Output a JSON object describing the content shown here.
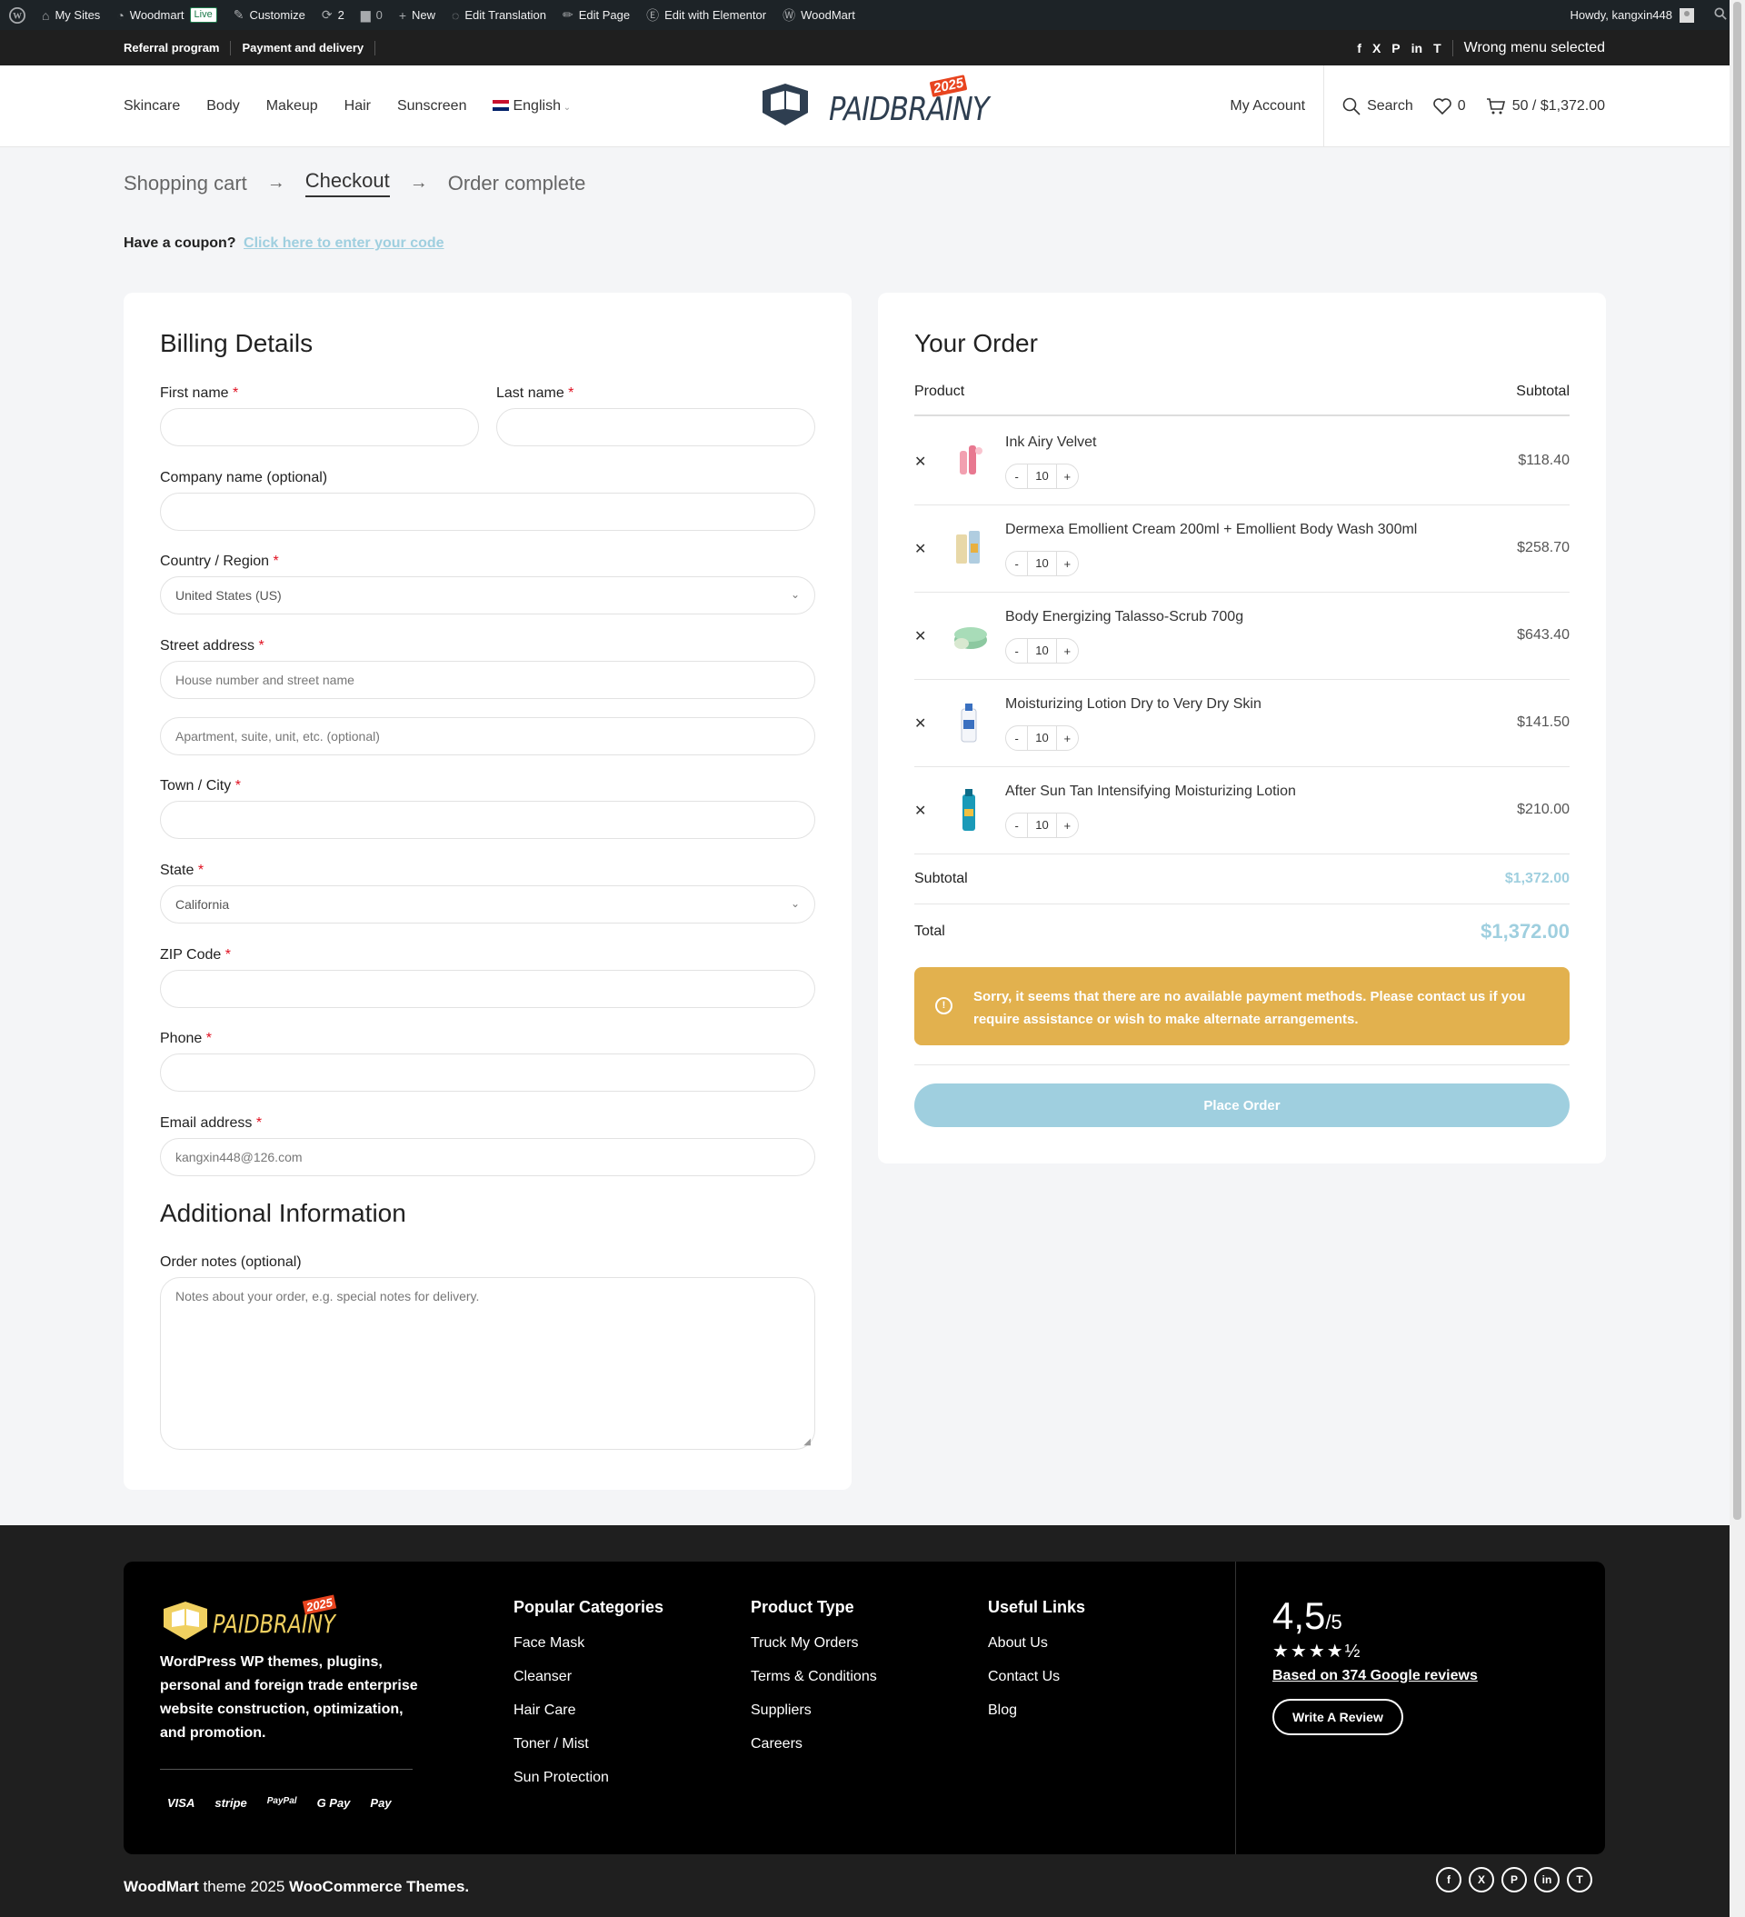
{
  "adminbar": {
    "items": [
      {
        "label": "My Sites",
        "icon": "my-sites-icon"
      },
      {
        "label": "Woodmart",
        "badge": "Live",
        "icon": "home-icon"
      },
      {
        "label": "Customize",
        "icon": "brush-icon"
      },
      {
        "label": "2",
        "icon": "updates-icon"
      },
      {
        "label": "0",
        "icon": "comments-icon"
      },
      {
        "label": "New",
        "icon": "plus-icon"
      },
      {
        "label": "Edit Translation",
        "icon": "translate-icon"
      },
      {
        "label": "Edit Page",
        "icon": "pencil-icon"
      },
      {
        "label": "Edit with Elementor",
        "icon": "elementor-icon"
      },
      {
        "label": "WoodMart",
        "icon": "woodmart-icon"
      }
    ],
    "howdy": "Howdy, kangxin448"
  },
  "topbar": {
    "links": [
      "Referral program",
      "Payment and delivery"
    ],
    "social": [
      "f",
      "X",
      "P",
      "in",
      "T"
    ],
    "menu_notice": "Wrong menu selected"
  },
  "header": {
    "nav": [
      "Skincare",
      "Body",
      "Makeup",
      "Hair",
      "Sunscreen"
    ],
    "language": "English",
    "logo_text": "PAIDBRAINY",
    "logo_year": "2025",
    "my_account": "My Account",
    "search": "Search",
    "wishlist_count": "0",
    "cart": "50 / $1,372.00"
  },
  "steps": {
    "cart": "Shopping cart",
    "checkout": "Checkout",
    "complete": "Order complete"
  },
  "coupon": {
    "text": "Have a coupon?",
    "link": "Click here to enter your code"
  },
  "billing": {
    "title": "Billing Details",
    "first_name": "First name",
    "last_name": "Last name",
    "company": "Company name (optional)",
    "country_label": "Country / Region",
    "country_value": "United States (US)",
    "street_label": "Street address",
    "street_ph1": "House number and street name",
    "street_ph2": "Apartment, suite, unit, etc. (optional)",
    "city": "Town / City",
    "state_label": "State",
    "state_value": "California",
    "zip": "ZIP Code",
    "phone": "Phone",
    "email_label": "Email address",
    "email_value": "kangxin448@126.com",
    "additional_title": "Additional Information",
    "notes_label": "Order notes (optional)",
    "notes_ph": "Notes about your order, e.g. special notes for delivery."
  },
  "order": {
    "title": "Your Order",
    "col_product": "Product",
    "col_subtotal": "Subtotal",
    "items": [
      {
        "name": "Ink Airy Velvet",
        "qty": "10",
        "price": "$118.40"
      },
      {
        "name": "Dermexa Emollient Cream 200ml + Emollient Body Wash 300ml",
        "qty": "10",
        "price": "$258.70"
      },
      {
        "name": "Body Energizing Talasso-Scrub 700g",
        "qty": "10",
        "price": "$643.40"
      },
      {
        "name": "Moisturizing Lotion Dry to Very Dry Skin",
        "qty": "10",
        "price": "$141.50"
      },
      {
        "name": "After Sun Tan Intensifying Moisturizing Lotion",
        "qty": "10",
        "price": "$210.00"
      }
    ],
    "subtotal_label": "Subtotal",
    "subtotal_value": "$1,372.00",
    "total_label": "Total",
    "total_value": "$1,372.00",
    "notice": "Sorry, it seems that there are no available payment methods. Please contact us if you require assistance or wish to make alternate arrangements.",
    "place_order": "Place Order"
  },
  "footer": {
    "description": "WordPress WP themes, plugins, personal and foreign trade enterprise website construction, optimization, and promotion.",
    "payments": [
      "VISA",
      "stripe",
      "PayPal",
      "G Pay",
      "Pay"
    ],
    "popular_title": "Popular Categories",
    "popular": [
      "Face Mask",
      "Cleanser",
      "Hair Care",
      "Toner / Mist",
      "Sun Protection"
    ],
    "type_title": "Product Type",
    "types": [
      "Truck My Orders",
      "Terms & Conditions",
      "Suppliers",
      "Careers"
    ],
    "useful_title": "Useful Links",
    "useful": [
      "About Us",
      "Contact Us",
      "Blog"
    ],
    "rating_value": "4,5",
    "rating_scale": "/5",
    "stars": "★★★★½",
    "reviews_link": "Based on 374 Google reviews",
    "write_review": "Write A Review",
    "copy_brand": "WoodMart",
    "copy_mid": " theme 2025 ",
    "copy_end": "WooCommerce Themes.",
    "social": [
      "f",
      "X",
      "P",
      "in",
      "T"
    ]
  },
  "colors": {
    "accent": "#9fcfdf",
    "notice": "#e2b14e",
    "dark": "#1f1f1f",
    "required": "#e01020"
  }
}
